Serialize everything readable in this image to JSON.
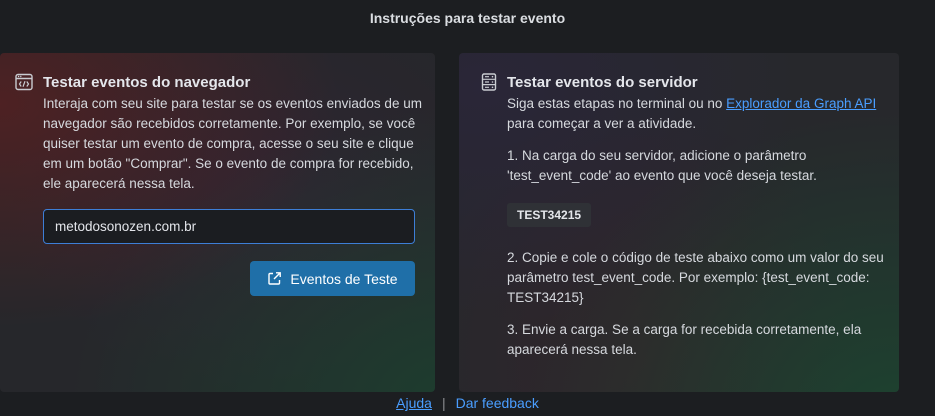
{
  "header": {
    "title": "Instruções para testar evento"
  },
  "browser_panel": {
    "heading": "Testar eventos do navegador",
    "icon": "browser-code-icon",
    "description": "Interaja com seu site para testar se os eventos enviados de um navegador são recebidos corretamente. Por exemplo, se você quiser testar um evento de compra, acesse o seu site e clique em um botão \"Comprar\". Se o evento de compra for recebido, ele aparecerá nessa tela.",
    "url_input_value": "metodosonozen.com.br",
    "test_button_label": "Eventos de Teste",
    "test_button_icon": "external-link-icon",
    "accent_color": "#1f6fa8"
  },
  "server_panel": {
    "heading": "Testar eventos do servidor",
    "icon": "server-icon",
    "intro_before_link": "Siga estas etapas no terminal ou no ",
    "intro_link": "Explorador da Graph API",
    "intro_after_link": " para começar a ver a atividade.",
    "step1": "1. Na carga do seu servidor, adicione o parâmetro 'test_event_code' ao evento que você deseja testar.",
    "test_code": "TEST34215",
    "step2": "2. Copie e cole o código de teste abaixo como um valor do seu parâmetro test_event_code. Por exemplo: {test_event_code: TEST34215}",
    "step3": "3. Envie a carga. Se a carga for recebida corretamente, ela aparecerá nessa tela."
  },
  "footer": {
    "help_label": "Ajuda",
    "separator": "|",
    "feedback_label": "Dar feedback"
  },
  "colors": {
    "link": "#4a9eff",
    "background": "#1c1e21"
  }
}
